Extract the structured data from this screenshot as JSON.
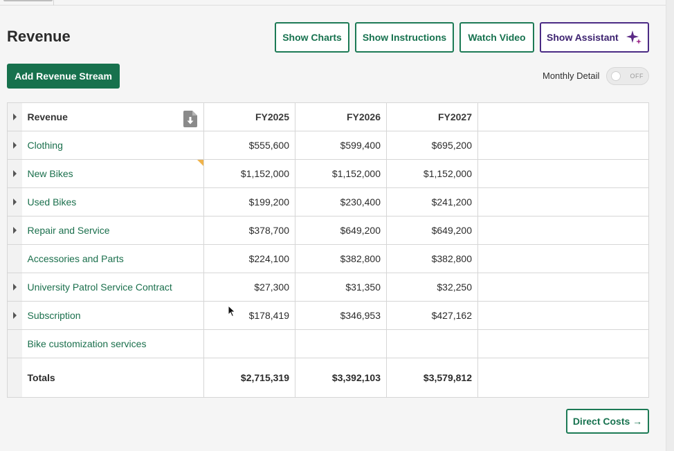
{
  "page": {
    "title": "Revenue"
  },
  "header_buttons": {
    "show_charts": "Show Charts",
    "show_instructions": "Show Instructions",
    "watch_video": "Watch Video",
    "show_assistant": "Show Assistant"
  },
  "actions": {
    "add_revenue_stream": "Add Revenue Stream",
    "direct_costs": "Direct Costs →"
  },
  "monthly_detail": {
    "label": "Monthly Detail",
    "state": "OFF"
  },
  "table": {
    "header": {
      "label": "Revenue",
      "years": [
        "FY2025",
        "FY2026",
        "FY2027"
      ]
    },
    "rows": [
      {
        "name": "Clothing",
        "expandable": true,
        "values": [
          "$555,600",
          "$599,400",
          "$695,200"
        ]
      },
      {
        "name": "New Bikes",
        "expandable": true,
        "values": [
          "$1,152,000",
          "$1,152,000",
          "$1,152,000"
        ]
      },
      {
        "name": "Used Bikes",
        "expandable": true,
        "values": [
          "$199,200",
          "$230,400",
          "$241,200"
        ]
      },
      {
        "name": "Repair and Service",
        "expandable": true,
        "values": [
          "$378,700",
          "$649,200",
          "$649,200"
        ]
      },
      {
        "name": "Accessories and Parts",
        "expandable": false,
        "values": [
          "$224,100",
          "$382,800",
          "$382,800"
        ]
      },
      {
        "name": "University Patrol Service Contract",
        "expandable": true,
        "values": [
          "$27,300",
          "$31,350",
          "$32,250"
        ]
      },
      {
        "name": "Subscription",
        "expandable": true,
        "values": [
          "$178,419",
          "$346,953",
          "$427,162"
        ]
      },
      {
        "name": "Bike customization services",
        "expandable": false,
        "values": [
          "",
          "",
          ""
        ]
      }
    ],
    "totals": {
      "label": "Totals",
      "values": [
        "$2,715,319",
        "$3,392,103",
        "$3,579,812"
      ]
    }
  },
  "colors": {
    "brand_green": "#17714d",
    "assistant_purple": "#4a2a84",
    "note_flag": "#f0b34a"
  },
  "icons": [
    "download-file-icon",
    "sparkle-icon",
    "expand-triangle-icon",
    "note-flag-icon",
    "mouse-cursor-icon"
  ]
}
